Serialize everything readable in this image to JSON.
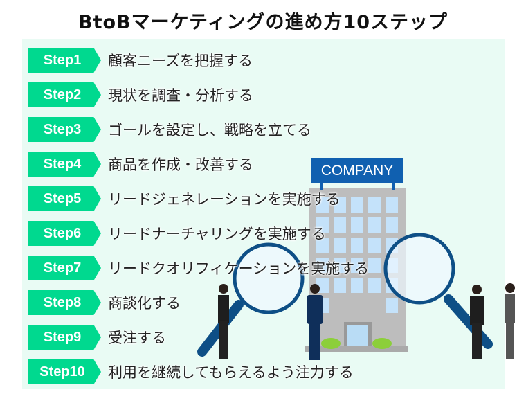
{
  "title": "BtoBマーケティングの進め方10ステップ",
  "colors": {
    "badge": "#00d98f",
    "panel": "#e9fbf4",
    "sign": "#1060b0"
  },
  "illustration": {
    "sign_text": "COMPANY"
  },
  "steps": [
    {
      "badge": "Step1",
      "text": "顧客ニーズを把握する"
    },
    {
      "badge": "Step2",
      "text": "現状を調査・分析する"
    },
    {
      "badge": "Step3",
      "text": "ゴールを設定し、戦略を立てる"
    },
    {
      "badge": "Step4",
      "text": "商品を作成・改善する"
    },
    {
      "badge": "Step5",
      "text": "リードジェネレーションを実施する"
    },
    {
      "badge": "Step6",
      "text": "リードナーチャリングを実施する"
    },
    {
      "badge": "Step7",
      "text": "リードクオリフィケーションを実施する"
    },
    {
      "badge": "Step8",
      "text": "商談化する"
    },
    {
      "badge": "Step9",
      "text": "受注する"
    },
    {
      "badge": "Step10",
      "text": "利用を継続してもらえるよう注力する"
    }
  ]
}
